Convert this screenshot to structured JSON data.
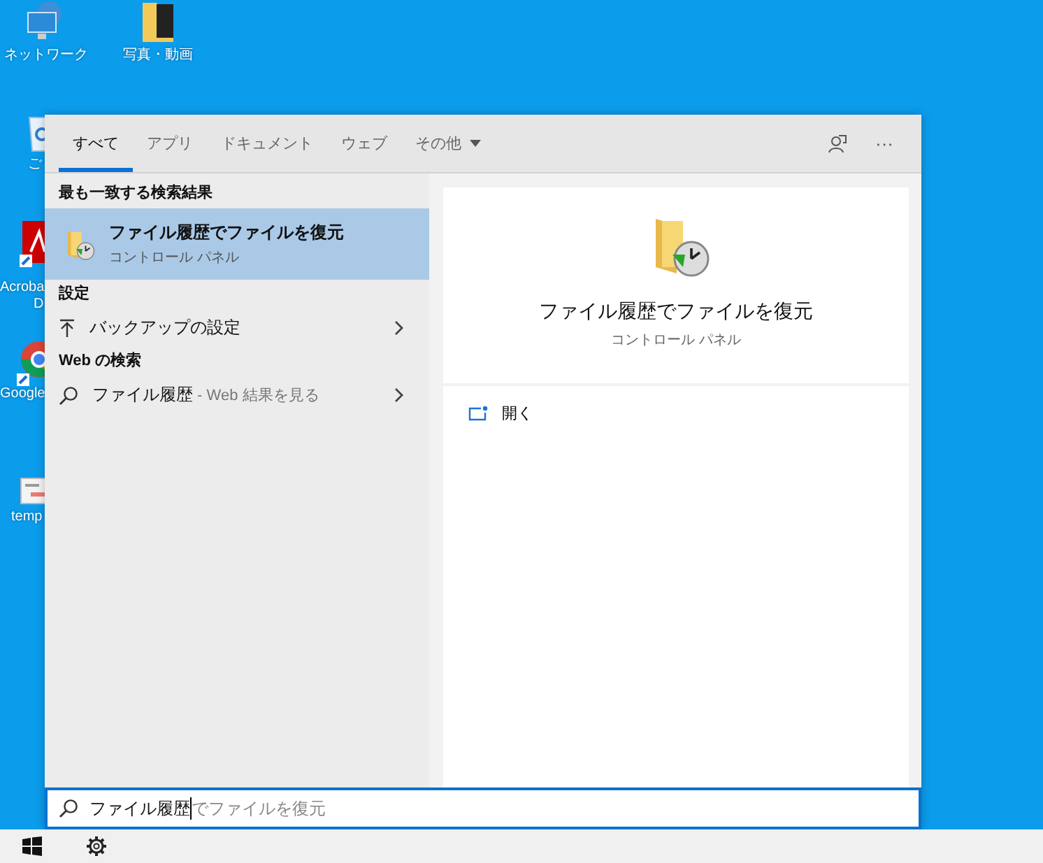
{
  "desktop_icons": [
    {
      "kind": "network",
      "lines": [
        "ネットワーク"
      ]
    },
    {
      "kind": "folder",
      "lines": [
        "写真・動画"
      ]
    },
    {
      "kind": "recycle",
      "lines": [
        "ご"
      ]
    },
    {
      "kind": "acrobat",
      "lines": [
        "Acroba",
        "D"
      ]
    },
    {
      "kind": "chrome",
      "lines": [
        "Google"
      ]
    },
    {
      "kind": "document",
      "lines": [
        "temp"
      ]
    }
  ],
  "tabs": [
    {
      "label": "すべて",
      "selected": true,
      "dropdown": false
    },
    {
      "label": "アプリ",
      "selected": false,
      "dropdown": false
    },
    {
      "label": "ドキュメント",
      "selected": false,
      "dropdown": false
    },
    {
      "label": "ウェブ",
      "selected": false,
      "dropdown": false
    },
    {
      "label": "その他",
      "selected": false,
      "dropdown": true
    }
  ],
  "more_button": "···",
  "sections": [
    {
      "heading": "最も一致する検索結果",
      "items": [
        {
          "kind": "app",
          "title": "ファイル履歴でファイルを復元",
          "subtitle": "コントロール パネル",
          "selected": true
        }
      ]
    },
    {
      "heading": "設定",
      "items": [
        {
          "kind": "setting",
          "title": "バックアップの設定",
          "selected": false
        }
      ]
    },
    {
      "heading": "Web の検索",
      "items": [
        {
          "kind": "web",
          "title": "ファイル履歴",
          "subtitle": " - Web 結果を見る",
          "selected": false
        }
      ]
    }
  ],
  "preview": {
    "title": "ファイル履歴でファイルを復元",
    "subtitle": "コントロール パネル",
    "actions": [
      {
        "label": "開く"
      }
    ]
  },
  "search": {
    "value": "ファイル履歴",
    "completion": "でファイルを復元"
  }
}
